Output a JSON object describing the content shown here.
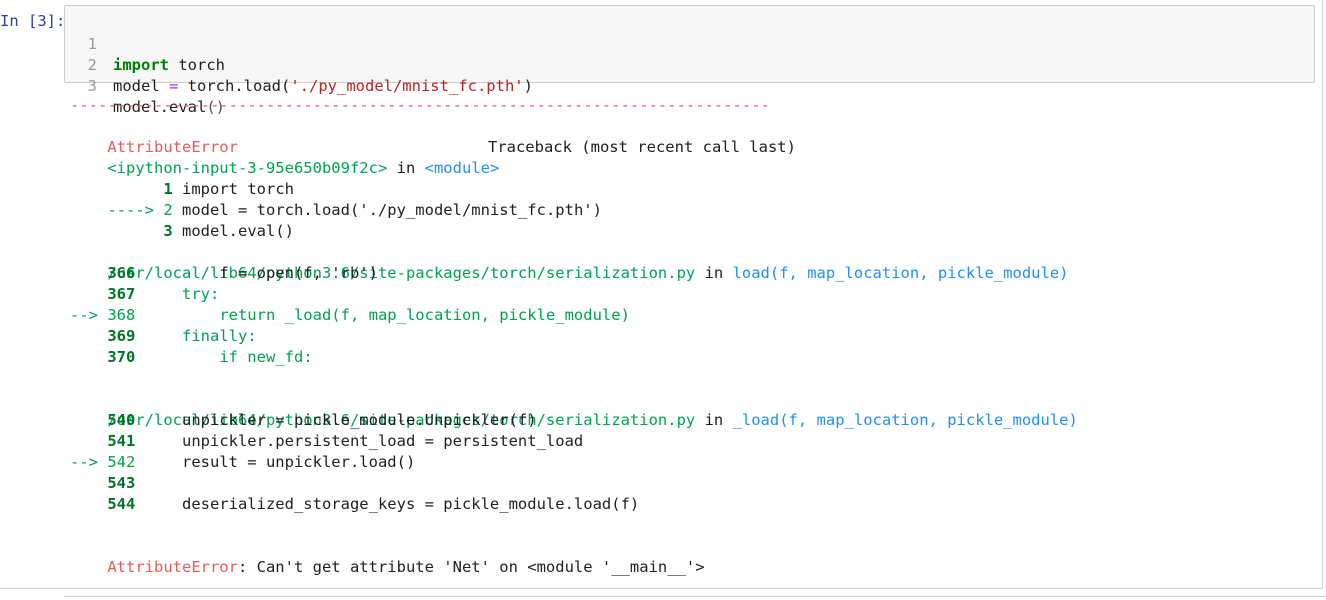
{
  "prompt": {
    "text": "In [3]:"
  },
  "input": {
    "lines": [
      {
        "no": "1",
        "kw": "import",
        "rest": " torch"
      },
      {
        "no": "2",
        "text_a": "model ",
        "op": "=",
        "text_b": " torch.load(",
        "str": "'./py_model/mnist_fc.pth'",
        "text_c": ")"
      },
      {
        "no": "3",
        "text_a": "model.eval",
        "paren": "()"
      }
    ]
  },
  "output": {
    "dashes": "---------------------------------------------------------------------------",
    "err_name": "AttributeError",
    "traceback_label": "Traceback (most recent call last)",
    "ipy_input": "<ipython-input-3-95e650b09f2c>",
    "in_word": " in ",
    "module_label": "<module>",
    "frame1": [
      {
        "marker": "      ",
        "no": "1",
        "code": " import torch"
      },
      {
        "marker": "----> ",
        "no": "2",
        "code": " model = torch.load('./py_model/mnist_fc.pth')"
      },
      {
        "marker": "      ",
        "no": "3",
        "code": " model.eval()"
      }
    ],
    "file_path": "/usr/local/lib64/python3.6/site-packages/torch/serialization.py",
    "func1": "load(f, map_location, pickle_module)",
    "frame2": [
      {
        "marker": "    ",
        "no": "366",
        "code": "         f = open(f, 'rb')"
      },
      {
        "marker": "    ",
        "no": "367",
        "code": "     try:"
      },
      {
        "marker": "--> ",
        "no": "368",
        "code": "         return _load(f, map_location, pickle_module)"
      },
      {
        "marker": "    ",
        "no": "369",
        "code": "     finally:"
      },
      {
        "marker": "    ",
        "no": "370",
        "code": "         if new_fd:"
      }
    ],
    "func2": "_load(f, map_location, pickle_module)",
    "frame3": [
      {
        "marker": "    ",
        "no": "540",
        "code": "     unpickler = pickle_module.Unpickler(f)"
      },
      {
        "marker": "    ",
        "no": "541",
        "code": "     unpickler.persistent_load = persistent_load"
      },
      {
        "marker": "--> ",
        "no": "542",
        "code": "     result = unpickler.load()"
      },
      {
        "marker": "    ",
        "no": "543",
        "code": ""
      },
      {
        "marker": "    ",
        "no": "544",
        "code": "     deserialized_storage_keys = pickle_module.load(f)"
      }
    ],
    "final_err": "AttributeError",
    "final_msg": ": Can't get attribute 'Net' on <module '__main__'>"
  }
}
